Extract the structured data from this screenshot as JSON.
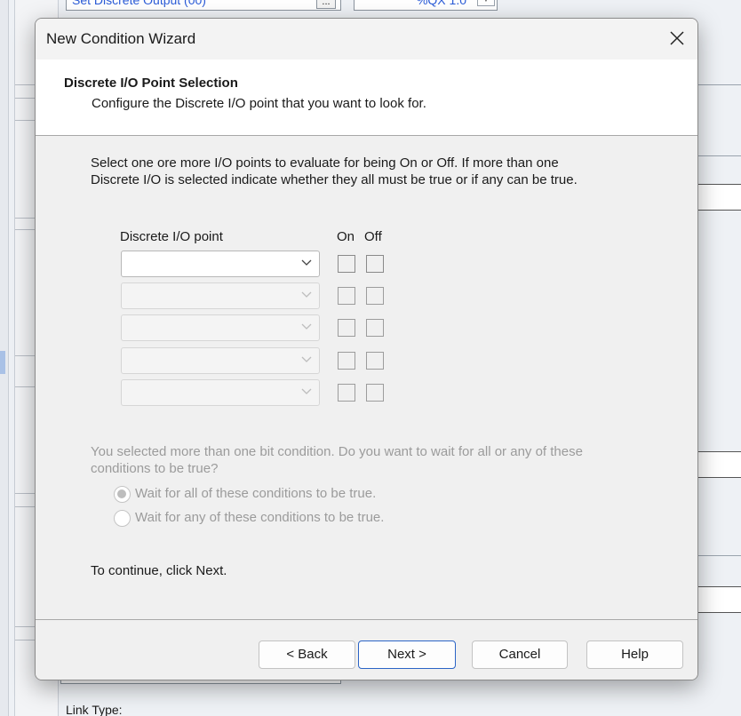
{
  "background": {
    "top_field_text": "Set Discrete Output (00)",
    "top_field2_text": "%QX 1.0",
    "dots_label": "...",
    "link_type_label": "Link Type:"
  },
  "dialog": {
    "title": "New Condition Wizard",
    "close_icon": "close-icon",
    "header": {
      "title": "Discrete I/O Point Selection",
      "subtitle": "Configure the Discrete I/O point that you want to look for."
    },
    "intro_line1": "Select one ore more I/O points to evaluate for being On or Off. If more than one",
    "intro_line2": "Discrete I/O is selected indicate whether they all must be true or if any can be true.",
    "columns": {
      "point": "Discrete I/O point",
      "on": "On",
      "off": "Off"
    },
    "rows": [
      {
        "value": "",
        "enabled": true,
        "on": false,
        "off": false
      },
      {
        "value": "",
        "enabled": false,
        "on": false,
        "off": false
      },
      {
        "value": "",
        "enabled": false,
        "on": false,
        "off": false
      },
      {
        "value": "",
        "enabled": false,
        "on": false,
        "off": false
      },
      {
        "value": "",
        "enabled": false,
        "on": false,
        "off": false
      }
    ],
    "question_line1": "You selected more than one bit condition. Do you want to wait for all or any of these",
    "question_line2": "conditions to be true?",
    "radio_all": "Wait for all of these conditions to be true.",
    "radio_any": "Wait for any of these conditions to be true.",
    "radio_selected": "all",
    "continue_text": "To continue, click Next.",
    "buttons": {
      "back": "< Back",
      "next": "Next >",
      "cancel": "Cancel",
      "help": "Help"
    }
  }
}
